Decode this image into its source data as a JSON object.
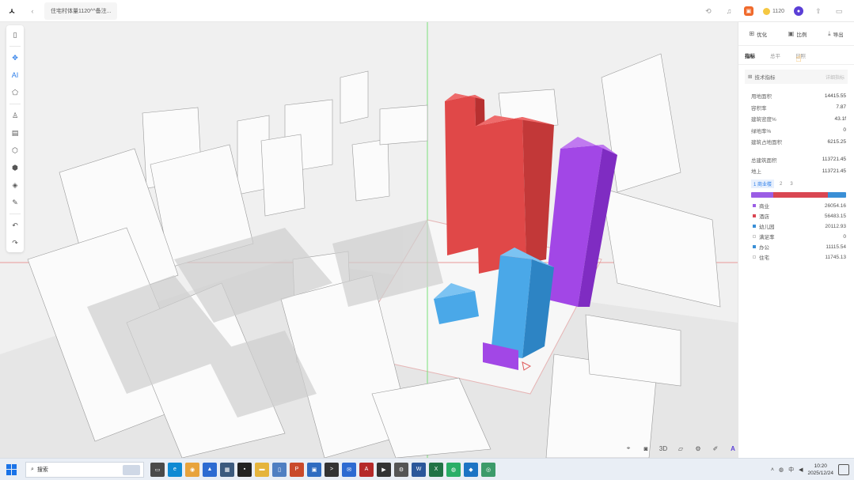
{
  "app": {
    "logo_glyph": "ㅅ",
    "back_glyph": "‹",
    "doc_title": "住宅村体量1120^^备注...",
    "top_right": {
      "history_icon": "history-icon",
      "notify_icon": "bell-icon",
      "coins": "1120",
      "avatar_letter": "●",
      "share_icon": "share-icon"
    }
  },
  "left_toolbar": {
    "items": [
      {
        "name": "panel-toggle-icon",
        "glyph": "▯"
      },
      {
        "name": "site-tool-icon",
        "glyph": "✥",
        "active": true
      },
      {
        "name": "ai-generate-icon",
        "glyph": "AI",
        "active": true
      },
      {
        "name": "boundary-icon",
        "glyph": "⬠"
      },
      {
        "name": "person-icon",
        "glyph": "♙"
      },
      {
        "name": "layer-icon",
        "glyph": "▤"
      },
      {
        "name": "cube-icon",
        "glyph": "⬡"
      },
      {
        "name": "box-icon",
        "glyph": "⬢"
      },
      {
        "name": "stack-icon",
        "glyph": "◈"
      },
      {
        "name": "ruler-icon",
        "glyph": "✎"
      },
      {
        "name": "undo-icon",
        "glyph": "↶"
      },
      {
        "name": "redo-icon",
        "glyph": "↷"
      }
    ]
  },
  "bottom_toolbar": {
    "items": [
      {
        "name": "fit-view-icon",
        "glyph": "⌖"
      },
      {
        "name": "camera-icon",
        "glyph": "◙"
      },
      {
        "name": "view-3d-button",
        "glyph": "3D"
      },
      {
        "name": "plan-icon",
        "glyph": "▱"
      },
      {
        "name": "settings-icon",
        "glyph": "⚙"
      },
      {
        "name": "brush-icon",
        "glyph": "✐"
      },
      {
        "name": "brand-icon",
        "glyph": "A"
      }
    ]
  },
  "right_panel": {
    "actions": [
      {
        "name": "optimize-button",
        "icon": "⊞",
        "label": "优化"
      },
      {
        "name": "compare-button",
        "icon": "▣",
        "label": "比例"
      },
      {
        "name": "export-button",
        "icon": "⤓",
        "label": "导出"
      }
    ],
    "tabs": [
      {
        "label": "指标",
        "active": true
      },
      {
        "label": "总平",
        "active": false
      },
      {
        "label": "日照",
        "active": false
      }
    ],
    "section": {
      "title": "技术指标",
      "extra": "详细指标"
    },
    "metrics": [
      {
        "k": "用地面积",
        "v": "14415.55"
      },
      {
        "k": "容积率",
        "v": "7.87"
      },
      {
        "k": "建筑密度%",
        "v": "43.1f"
      },
      {
        "k": "绿地率%",
        "v": "0"
      },
      {
        "k": "建筑占地面积",
        "v": "6215.25"
      }
    ],
    "totals": [
      {
        "k": "总建筑面积",
        "v": "113721.45"
      },
      {
        "k": "地上",
        "v": "113721.45"
      }
    ],
    "level_tabs": [
      "1 商业楼",
      "2",
      "3"
    ],
    "ratio_colors": [
      "#9b5de5",
      "#d94652",
      "#3a8fd6"
    ],
    "ratio_values": [
      0.23,
      0.58,
      0.19
    ],
    "uses": [
      {
        "k": "商业",
        "v": "26054.16",
        "color": "#9b5de5"
      },
      {
        "k": "酒店",
        "v": "56483.15",
        "color": "#d94652"
      },
      {
        "k": "幼儿园",
        "v": "20112.93",
        "color": "#3a8fd6"
      },
      {
        "k": "满足率",
        "v": "0",
        "color": "#ffffff"
      },
      {
        "k": "办公",
        "v": "11115.54",
        "color": "#3a8fd6"
      },
      {
        "k": "住宅",
        "v": "11745.13",
        "color": "#ffffff"
      }
    ]
  },
  "taskbar": {
    "search_placeholder": "搜索",
    "apps": [
      {
        "name": "taskview-icon",
        "color": "#4a4a4a",
        "glyph": "▭"
      },
      {
        "name": "edge-icon",
        "color": "#0f8ad3",
        "glyph": "e"
      },
      {
        "name": "chrome-icon",
        "color": "#e8a33c",
        "glyph": "◉"
      },
      {
        "name": "app-blue-icon",
        "color": "#2d6bd1",
        "glyph": "▲"
      },
      {
        "name": "calculator-icon",
        "color": "#3c5a7d",
        "glyph": "▦"
      },
      {
        "name": "app-dark-icon",
        "color": "#222",
        "glyph": "▪"
      },
      {
        "name": "folder-icon",
        "color": "#e5b43c",
        "glyph": "▬"
      },
      {
        "name": "notepad-icon",
        "color": "#4f7fc2",
        "glyph": "▯"
      },
      {
        "name": "powerpoint-icon",
        "color": "#c94a2b",
        "glyph": "P"
      },
      {
        "name": "photos-icon",
        "color": "#2f6cc0",
        "glyph": "▣"
      },
      {
        "name": "terminal-icon",
        "color": "#333",
        "glyph": ">"
      },
      {
        "name": "mail-icon",
        "color": "#2d6bd1",
        "glyph": "✉"
      },
      {
        "name": "autocad-icon",
        "color": "#b52a2a",
        "glyph": "A"
      },
      {
        "name": "media-icon",
        "color": "#333",
        "glyph": "▶"
      },
      {
        "name": "settings-app-icon",
        "color": "#555",
        "glyph": "⚙"
      },
      {
        "name": "word-icon",
        "color": "#2b579a",
        "glyph": "W"
      },
      {
        "name": "excel-icon",
        "color": "#217346",
        "glyph": "X"
      },
      {
        "name": "wechat-icon",
        "color": "#2aae67",
        "glyph": "◍"
      },
      {
        "name": "vscode-icon",
        "color": "#1d74c4",
        "glyph": "◆"
      },
      {
        "name": "app-green-icon",
        "color": "#3c9b6a",
        "glyph": "◎"
      }
    ],
    "tray": {
      "lang": "中",
      "time": "10:20",
      "date": "2025/12/24"
    }
  }
}
